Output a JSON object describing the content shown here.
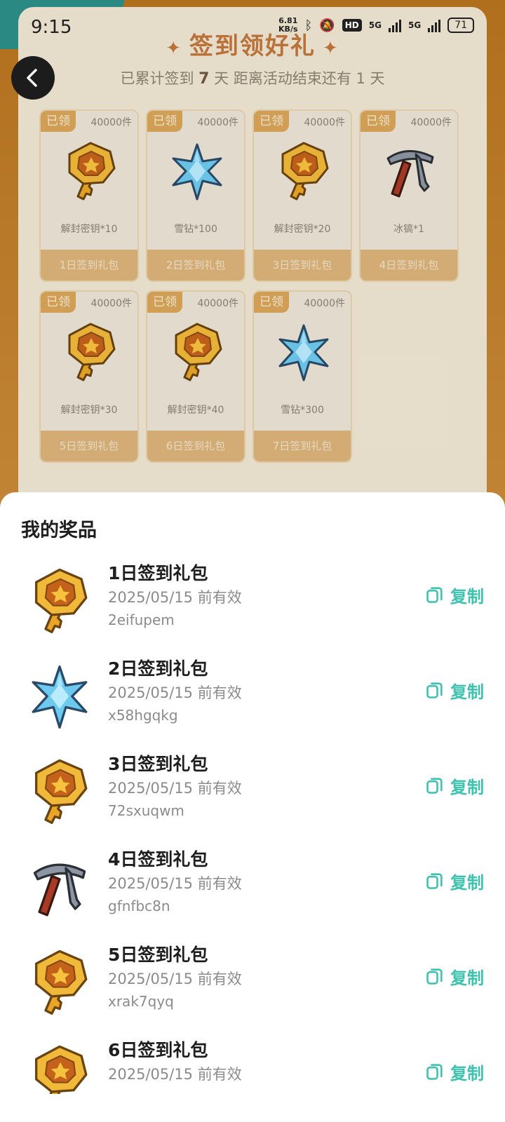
{
  "status_bar": {
    "time": "9:15",
    "speed_value": "6.81",
    "speed_unit": "KB/s",
    "hd": "HD",
    "net1": "5G",
    "net2": "5G",
    "battery": "71"
  },
  "activity": {
    "title": "签到领好礼",
    "info_prefix": "已累计签到",
    "days": "7",
    "info_suffix": "天  距离活动结束还有 1 天",
    "cards": [
      {
        "badge": "已领",
        "qty": "40000件",
        "item": "解封密钥*10",
        "icon": "key-icon",
        "footer": "1日签到礼包"
      },
      {
        "badge": "已领",
        "qty": "40000件",
        "item": "雪钻*100",
        "icon": "snow-diamond-icon",
        "footer": "2日签到礼包"
      },
      {
        "badge": "已领",
        "qty": "40000件",
        "item": "解封密钥*20",
        "icon": "key-icon",
        "footer": "3日签到礼包"
      },
      {
        "badge": "已领",
        "qty": "40000件",
        "item": "冰镐*1",
        "icon": "pickaxe-icon",
        "footer": "4日签到礼包"
      },
      {
        "badge": "已领",
        "qty": "40000件",
        "item": "解封密钥*30",
        "icon": "key-icon",
        "footer": "5日签到礼包"
      },
      {
        "badge": "已领",
        "qty": "40000件",
        "item": "解封密钥*40",
        "icon": "key-icon",
        "footer": "6日签到礼包"
      },
      {
        "badge": "已领",
        "qty": "40000件",
        "item": "雪钻*300",
        "icon": "snow-diamond-icon",
        "footer": "7日签到礼包"
      }
    ]
  },
  "sheet": {
    "title": "我的奖品",
    "copy_label": "复制",
    "prizes": [
      {
        "title": "1日签到礼包",
        "validity": "2025/05/15 前有效",
        "code": "2eifupem",
        "icon": "key-icon"
      },
      {
        "title": "2日签到礼包",
        "validity": "2025/05/15 前有效",
        "code": "x58hgqkg",
        "icon": "snow-diamond-icon"
      },
      {
        "title": "3日签到礼包",
        "validity": "2025/05/15 前有效",
        "code": "72sxuqwm",
        "icon": "key-icon"
      },
      {
        "title": "4日签到礼包",
        "validity": "2025/05/15 前有效",
        "code": "gfnfbc8n",
        "icon": "pickaxe-icon"
      },
      {
        "title": "5日签到礼包",
        "validity": "2025/05/15 前有效",
        "code": "xrak7qyq",
        "icon": "key-icon"
      },
      {
        "title": "6日签到礼包",
        "validity": "2025/05/15 前有效",
        "code": "",
        "icon": "key-icon"
      }
    ]
  }
}
